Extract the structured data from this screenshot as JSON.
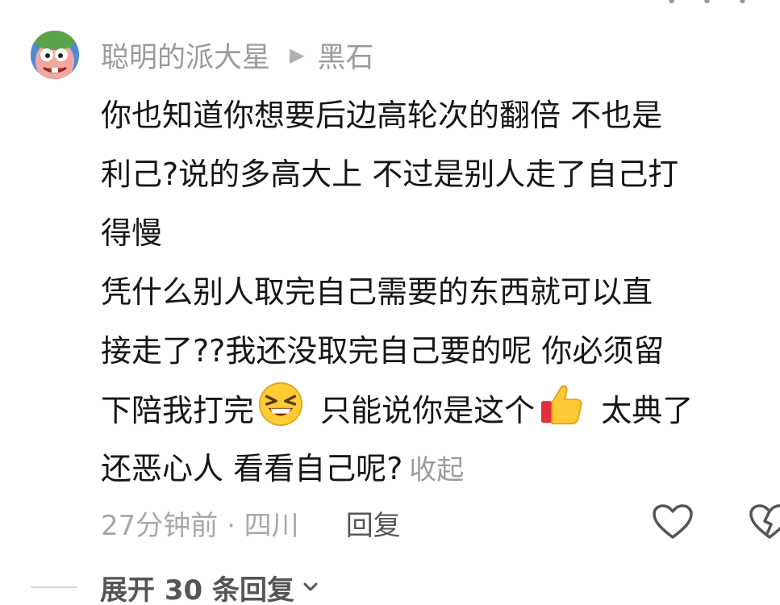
{
  "comment": {
    "username": "聪明的派大星",
    "reply_to": "黑石",
    "lines": [
      "你也知道你想要后边高轮次的翻倍 不也是",
      "利己?说的多高大上 不过是别人走了自己打",
      "得慢",
      " 凭什么别人取完自己需要的东西就可以直",
      "接走了??我还没取完自己要的呢 你必须留"
    ],
    "line6_a": "下陪我打完",
    "line6_b": " 只能说你是这个",
    "line6_c": " 太典了",
    "line7": "还恶心人 看看自己呢?",
    "collapse_label": "收起",
    "meta": "27分钟前 · 四川",
    "reply_label": "回复",
    "expand_label": "展开 30 条回复"
  },
  "icons": {
    "avatar": "cartoon-avatar",
    "reply_arrow": "triangle-right-icon",
    "emoji1": "grinning-squint-emoji",
    "emoji2": "thumbs-up-emoji",
    "like": "heart-outline-icon",
    "dislike": "broken-heart-icon",
    "expand": "chevron-down-icon"
  },
  "colors": {
    "text": "#161616",
    "muted": "#9b9b9b",
    "background": "#ffffff"
  }
}
